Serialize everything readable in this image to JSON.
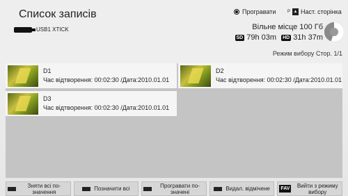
{
  "header": {
    "title": "Список записів",
    "device_label": "USB1 XTICK",
    "play_label": "Програвати",
    "next_page_label": "Наст. сторінка",
    "free_space": "Вільне місце 100 Гб",
    "sd_badge": "SD",
    "sd_time": "79h 03m",
    "hd_badge": "HD",
    "hd_time": "31h 37m",
    "mode_label": "Режим вибору",
    "page_label": "Стор. 1/1"
  },
  "recordings": [
    {
      "name": "D1",
      "info": "Час відтворення: 00:02:30 /Дата:2010.01.01"
    },
    {
      "name": "D2",
      "info": "Час відтворення: 00:02:30 /Дата:2010.01.01"
    },
    {
      "name": "D3",
      "info": "Час відтворення: 00:02:30 /Дата:2010.01.01"
    }
  ],
  "footer": {
    "btn1": "Зняти всі по-значення",
    "btn2": "Позначити всі",
    "btn3": "Програвати по-значені",
    "btn4": "Видал. відмічене",
    "btn5": "Вийти з режиму вибору",
    "fav_label": "FAV"
  }
}
